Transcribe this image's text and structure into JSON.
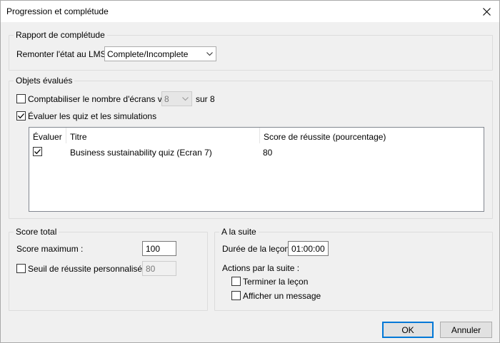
{
  "window": {
    "title": "Progression et complétude"
  },
  "rapport": {
    "legend": "Rapport de complétude",
    "label": "Remonter l'état au LMS :",
    "value": "Complete/Incomplete"
  },
  "objets": {
    "legend": "Objets évalués",
    "ecrans": {
      "label": "Comptabiliser le nombre d'écrans vus :",
      "checked": false,
      "value": "8",
      "suffix": "sur 8"
    },
    "quiz": {
      "label": "Évaluer les quiz et les simulations",
      "checked": true
    },
    "table": {
      "columns": [
        "Évaluer",
        "Titre",
        "Score de réussite (pourcentage)"
      ],
      "rows": [
        {
          "evaluer": true,
          "titre": "Business sustainability quiz (Ecran 7)",
          "score": "80"
        }
      ]
    }
  },
  "score": {
    "legend": "Score total",
    "max_label": "Score maximum :",
    "max_value": "100",
    "seuil_label": "Seuil de réussite personnalisé :",
    "seuil_checked": false,
    "seuil_value": "80"
  },
  "suite": {
    "legend": "A la suite",
    "duree_label": "Durée de la leçon :",
    "duree_value": "01:00:00",
    "actions_label": "Actions par la suite :",
    "terminer_label": "Terminer la leçon",
    "afficher_label": "Afficher un message"
  },
  "buttons": {
    "ok": "OK",
    "cancel": "Annuler"
  },
  "colors": {
    "accent": "#0078d7",
    "background": "#f0f0f0",
    "border": "#dcdcdc"
  }
}
